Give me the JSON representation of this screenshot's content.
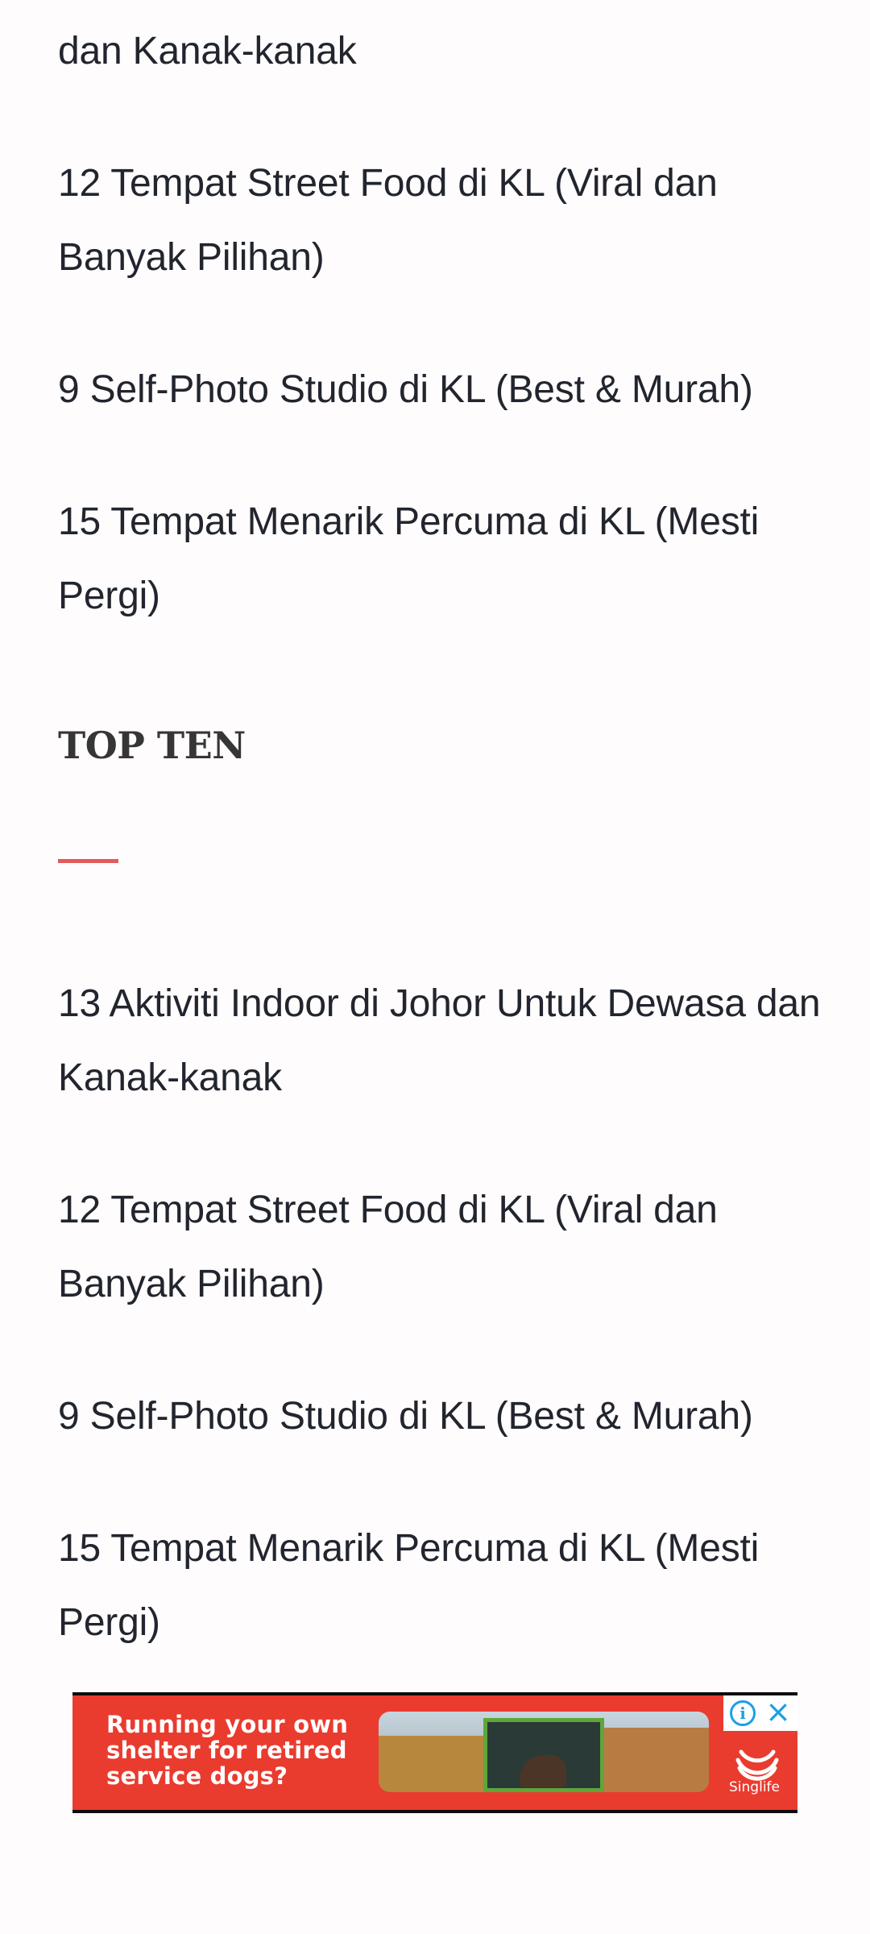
{
  "partial_item": {
    "label": "dan Kanak-kanak"
  },
  "recent_posts": [
    {
      "label": "12 Tempat Street Food di KL (Viral dan Banyak Pilihan)"
    },
    {
      "label": "9 Self-Photo Studio di KL (Best & Murah)"
    },
    {
      "label": "15 Tempat Menarik Percuma di KL (Mesti Pergi)"
    }
  ],
  "top_ten": {
    "heading": "TOP TEN",
    "accent_color": "#e45b5b",
    "items": [
      {
        "label": "13 Aktiviti Indoor di Johor Untuk Dewasa dan Kanak-kanak"
      },
      {
        "label": "12 Tempat Street Food di KL (Viral dan Banyak Pilihan)"
      },
      {
        "label": "9 Self-Photo Studio di KL (Best & Murah)"
      },
      {
        "label": "15 Tempat Menarik Percuma di KL (Mesti Pergi)"
      }
    ]
  },
  "ad": {
    "text": "Running your own shelter for retired service dogs?",
    "brand": "Singlife",
    "background_color": "#ea3b2f",
    "info_icon": "adchoices-info-icon",
    "close_icon": "close-icon"
  }
}
